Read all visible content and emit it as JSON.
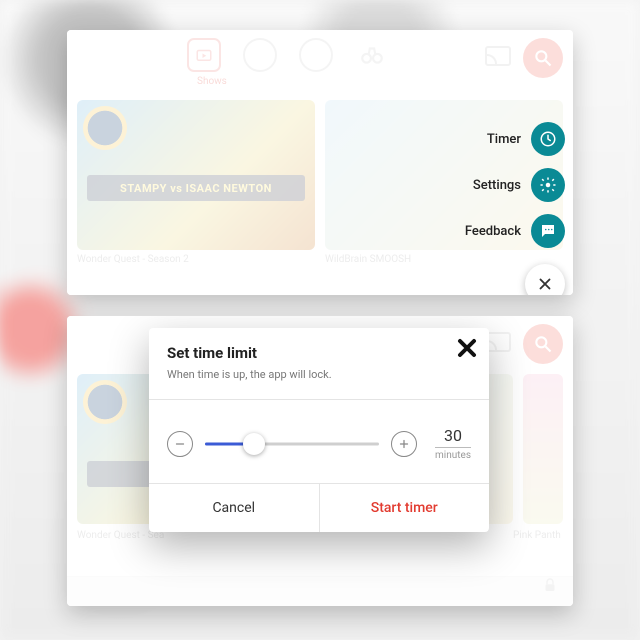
{
  "nav": {
    "shows_label": "Shows"
  },
  "fab_menu": {
    "items": [
      {
        "label": "Timer"
      },
      {
        "label": "Settings"
      },
      {
        "label": "Feedback"
      }
    ]
  },
  "top_captions": {
    "a": "Wonder Quest - Season 2",
    "b": "WildBrain SMOOSH"
  },
  "thumb_text": {
    "stampy": "STAMPY vs ISAAC NEWTON"
  },
  "bottom_captions": {
    "a": "Wonder Quest - Sea",
    "c": "Pink Panth"
  },
  "dialog": {
    "title": "Set time limit",
    "subtitle": "When time is up, the app will lock.",
    "value": "30",
    "unit": "minutes",
    "cancel": "Cancel",
    "start": "Start timer"
  }
}
